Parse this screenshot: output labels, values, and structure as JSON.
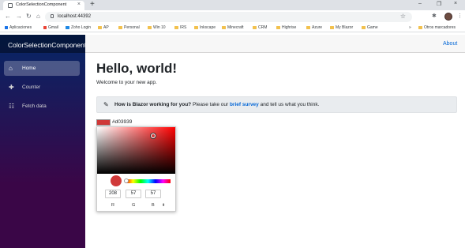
{
  "browser": {
    "tab_title": "ColorSelectionComponent",
    "tab_close": "×",
    "new_tab": "+",
    "url": "localhost:44392",
    "window_controls": [
      "–",
      "❐",
      "×"
    ],
    "nav": {
      "back": "←",
      "forward": "→",
      "reload": "↻",
      "home": "⌂"
    },
    "star": "☆",
    "extensions": "✱",
    "menu": "⋮"
  },
  "bookmarks": {
    "items": [
      {
        "label": "Aplicaciones",
        "icon": "apps-icon"
      },
      {
        "label": "Gmail",
        "icon": "gmail-icon"
      },
      {
        "label": "Zoho Login",
        "icon": "zoho-icon"
      },
      {
        "label": "AP",
        "icon": "folder-icon"
      },
      {
        "label": "Personal",
        "icon": "folder-icon"
      },
      {
        "label": "Win 10",
        "icon": "folder-icon"
      },
      {
        "label": "IRS",
        "icon": "folder-icon"
      },
      {
        "label": "Inkscape",
        "icon": "folder-icon"
      },
      {
        "label": "Minecraft",
        "icon": "folder-icon"
      },
      {
        "label": "CRM",
        "icon": "folder-icon"
      },
      {
        "label": "Highrise",
        "icon": "folder-icon"
      },
      {
        "label": "Azure",
        "icon": "folder-icon"
      },
      {
        "label": "My Blazor",
        "icon": "folder-icon"
      },
      {
        "label": "Game",
        "icon": "folder-icon"
      }
    ],
    "more": "»",
    "other": "Otros marcadores"
  },
  "app": {
    "brand": "ColorSelectionComponent",
    "about": "About",
    "nav": [
      {
        "label": "Home",
        "icon": "home-icon",
        "glyph": "⌂",
        "active": true
      },
      {
        "label": "Counter",
        "icon": "plus-icon",
        "glyph": "✚",
        "active": false
      },
      {
        "label": "Fetch data",
        "icon": "list-icon",
        "glyph": "☷",
        "active": false
      }
    ],
    "heading": "Hello, world!",
    "welcome": "Welcome to your new app.",
    "survey": {
      "bold": "How is Blazor working for you?",
      "text_before": " Please take our ",
      "link": "brief survey",
      "text_after": " and tell us what you think."
    }
  },
  "color_picker": {
    "hex": "#d03939",
    "color": "#d03939",
    "r": "208",
    "g": "57",
    "b": "57",
    "labels": [
      "R",
      "G",
      "B"
    ],
    "mode_toggle": "⬍"
  }
}
